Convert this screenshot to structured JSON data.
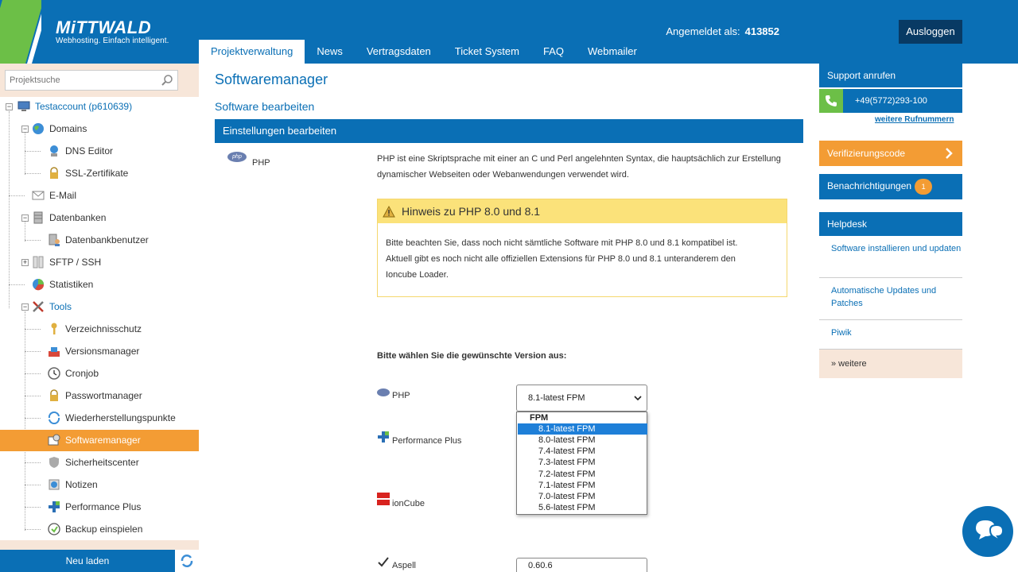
{
  "header": {
    "brand": "MiTTWALD",
    "tagline": "Webhosting. Einfach intelligent.",
    "login_label": "Angemeldet als:",
    "login_user": "413852",
    "logout_label": "Ausloggen"
  },
  "nav": {
    "items": [
      "Projektverwaltung",
      "News",
      "Vertragsdaten",
      "Ticket System",
      "FAQ",
      "Webmailer"
    ],
    "active": "Projektverwaltung"
  },
  "sidebar": {
    "search_placeholder": "Projektsuche",
    "tree": [
      "Testaccount (p610639)",
      "Domains",
      "DNS Editor",
      "SSL-Zertifikate",
      "E-Mail",
      "Datenbanken",
      "Datenbankbenutzer",
      "SFTP / SSH",
      "Statistiken",
      "Tools",
      "Verzeichnisschutz",
      "Versionsmanager",
      "Cronjob",
      "Passwortmanager",
      "Wiederherstellungspunkte",
      "Softwaremanager",
      "Sicherheitscenter",
      "Notizen",
      "Performance Plus",
      "Backup einspielen"
    ],
    "active_item": "Softwaremanager",
    "reload_label": "Neu laden"
  },
  "main": {
    "title": "Softwaremanager",
    "subtitle": "Software bearbeiten",
    "section": "Einstellungen bearbeiten",
    "php_badge": "php",
    "php_label": "PHP",
    "php_description": "PHP ist eine Skriptsprache mit einer an C und Perl angelehnten Syntax, die hauptsächlich zur Erstellung dynamischer Webseiten oder Webanwendungen verwendet wird.",
    "notice_title": "Hinweis zu PHP 8.0 und 8.1",
    "notice_line1": "Bitte beachten Sie, dass noch nicht sämtliche Software mit PHP 8.0 und 8.1 kompatibel ist.",
    "notice_line2": "Aktuell gibt es noch nicht alle offiziellen Extensions für PHP 8.0 und 8.1 unteranderem den",
    "notice_line3": "Ioncube Loader.",
    "choose_label": "Bitte wählen Sie die gewünschte Version aus:",
    "options": {
      "php": "PHP",
      "performance_plus": "Performance Plus",
      "ioncube": "ionCube",
      "aspell": "Aspell"
    },
    "php_select_value": "8.1-latest FPM",
    "dropdown_group": "FPM",
    "dropdown_options": [
      "8.1-latest FPM",
      "8.0-latest FPM",
      "7.4-latest FPM",
      "7.3-latest FPM",
      "7.2-latest FPM",
      "7.1-latest FPM",
      "7.0-latest FPM",
      "5.6-latest FPM"
    ],
    "dropdown_selected": "8.1-latest FPM",
    "aspell_select_value": "0.60.6"
  },
  "right": {
    "support_title": "Support anrufen",
    "phone": "+49(5772)293-100",
    "more_numbers": "weitere Rufnummern",
    "verify_label": "Verifizierungscode",
    "notifications_label": "Benachrichtigungen",
    "notifications_count": "1",
    "helpdesk_title": "Helpdesk",
    "help_items": [
      "Software installieren und updaten",
      "Automatische Updates und Patches",
      "Piwik"
    ],
    "help_more": "» weitere"
  },
  "colors": {
    "brand_blue": "#0a6fb5",
    "accent_orange": "#f39c34",
    "brand_green": "#6cbf47",
    "notice_yellow": "#fbe27a"
  }
}
